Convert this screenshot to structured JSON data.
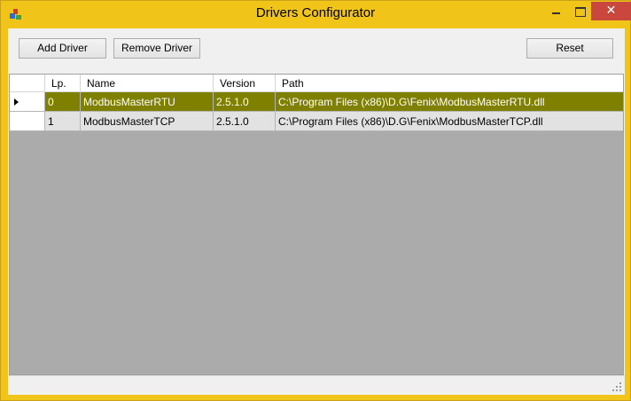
{
  "window": {
    "title": "Drivers Configurator",
    "close_glyph": "✕"
  },
  "toolbar": {
    "add_label": "Add Driver",
    "remove_label": "Remove Driver",
    "reset_label": "Reset"
  },
  "grid": {
    "columns": [
      "Lp.",
      "Name",
      "Version",
      "Path"
    ],
    "rows": [
      [
        "0",
        "ModbusMasterRTU",
        "2.5.1.0",
        "C:\\Program Files (x86)\\D.G\\Fenix\\ModbusMasterRTU.dll"
      ],
      [
        "1",
        "ModbusMasterTCP",
        "2.5.1.0",
        "C:\\Program Files (x86)\\D.G\\Fenix\\ModbusMasterTCP.dll"
      ]
    ],
    "selected_row": 0
  },
  "colors": {
    "frame": "#f0c419",
    "selection": "#808000",
    "close": "#c9473d"
  },
  "icons": {
    "app": "app-logo-icon",
    "row_marker": "row-pointer-icon",
    "resize": "resize-grip-icon"
  }
}
